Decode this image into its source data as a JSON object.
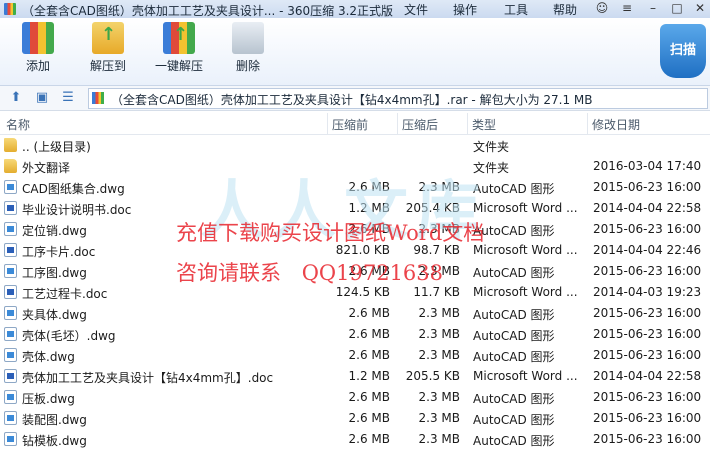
{
  "window": {
    "title": "（全套含CAD图纸）壳体加工工艺及夹具设计... - 360压缩 3.2正式版",
    "menus": [
      "文件",
      "操作",
      "工具",
      "帮助"
    ]
  },
  "toolbar": {
    "add": "添加",
    "extract_to": "解压到",
    "one_click_extract": "一键解压",
    "delete": "删除",
    "scan": "扫描"
  },
  "address": "（全套含CAD图纸）壳体加工工艺及夹具设计【钻4x4mm孔】.rar - 解包大小为 27.1 MB",
  "columns": {
    "name": "名称",
    "compressed_before": "压缩前",
    "compressed_after": "压缩后",
    "type": "类型",
    "modified": "修改日期"
  },
  "files": [
    {
      "icon": "folder-icon",
      "name": ".. (上级目录)",
      "before": "",
      "after": "",
      "type": "文件夹",
      "date": ""
    },
    {
      "icon": "folder-icon",
      "name": "外文翻译",
      "before": "",
      "after": "",
      "type": "文件夹",
      "date": "2016-03-04 17:40"
    },
    {
      "icon": "dwg-file-icon",
      "name": "CAD图纸集合.dwg",
      "before": "2.6 MB",
      "after": "2.3 MB",
      "type": "AutoCAD 图形",
      "date": "2015-06-23 16:00"
    },
    {
      "icon": "doc-file-icon",
      "name": "毕业设计说明书.doc",
      "before": "1.2 MB",
      "after": "205.4 KB",
      "type": "Microsoft Word ...",
      "date": "2014-04-04 22:58"
    },
    {
      "icon": "dwg-file-icon",
      "name": "定位销.dwg",
      "before": "2.6 MB",
      "after": "2.3 MB",
      "type": "AutoCAD 图形",
      "date": "2015-06-23 16:00"
    },
    {
      "icon": "doc-file-icon",
      "name": "工序卡片.doc",
      "before": "821.0 KB",
      "after": "98.7 KB",
      "type": "Microsoft Word ...",
      "date": "2014-04-04 22:46"
    },
    {
      "icon": "dwg-file-icon",
      "name": "工序图.dwg",
      "before": "2.6 MB",
      "after": "2.3 MB",
      "type": "AutoCAD 图形",
      "date": "2015-06-23 16:00"
    },
    {
      "icon": "doc-file-icon",
      "name": "工艺过程卡.doc",
      "before": "124.5 KB",
      "after": "11.7 KB",
      "type": "Microsoft Word ...",
      "date": "2014-04-03 19:23"
    },
    {
      "icon": "dwg-file-icon",
      "name": "夹具体.dwg",
      "before": "2.6 MB",
      "after": "2.3 MB",
      "type": "AutoCAD 图形",
      "date": "2015-06-23 16:00"
    },
    {
      "icon": "dwg-file-icon",
      "name": "壳体(毛坯）.dwg",
      "before": "2.6 MB",
      "after": "2.3 MB",
      "type": "AutoCAD 图形",
      "date": "2015-06-23 16:00"
    },
    {
      "icon": "dwg-file-icon",
      "name": "壳体.dwg",
      "before": "2.6 MB",
      "after": "2.3 MB",
      "type": "AutoCAD 图形",
      "date": "2015-06-23 16:00"
    },
    {
      "icon": "doc-file-icon",
      "name": "壳体加工工艺及夹具设计【钻4x4mm孔】.doc",
      "before": "1.2 MB",
      "after": "205.5 KB",
      "type": "Microsoft Word ...",
      "date": "2014-04-04 22:58"
    },
    {
      "icon": "dwg-file-icon",
      "name": "压板.dwg",
      "before": "2.6 MB",
      "after": "2.3 MB",
      "type": "AutoCAD 图形",
      "date": "2015-06-23 16:00"
    },
    {
      "icon": "dwg-file-icon",
      "name": "装配图.dwg",
      "before": "2.6 MB",
      "after": "2.3 MB",
      "type": "AutoCAD 图形",
      "date": "2015-06-23 16:00"
    },
    {
      "icon": "dwg-file-icon",
      "name": "钻模板.dwg",
      "before": "2.6 MB",
      "after": "2.3 MB",
      "type": "AutoCAD 图形",
      "date": "2015-06-23 16:00"
    }
  ],
  "watermark": {
    "line1": "充值下载购买设计图纸Word文档",
    "line2": "咨询请联系",
    "qq": "QQ1972163",
    "qq_suffix": "8",
    "logo_text": "人人文库",
    "color": "#e8242c"
  }
}
